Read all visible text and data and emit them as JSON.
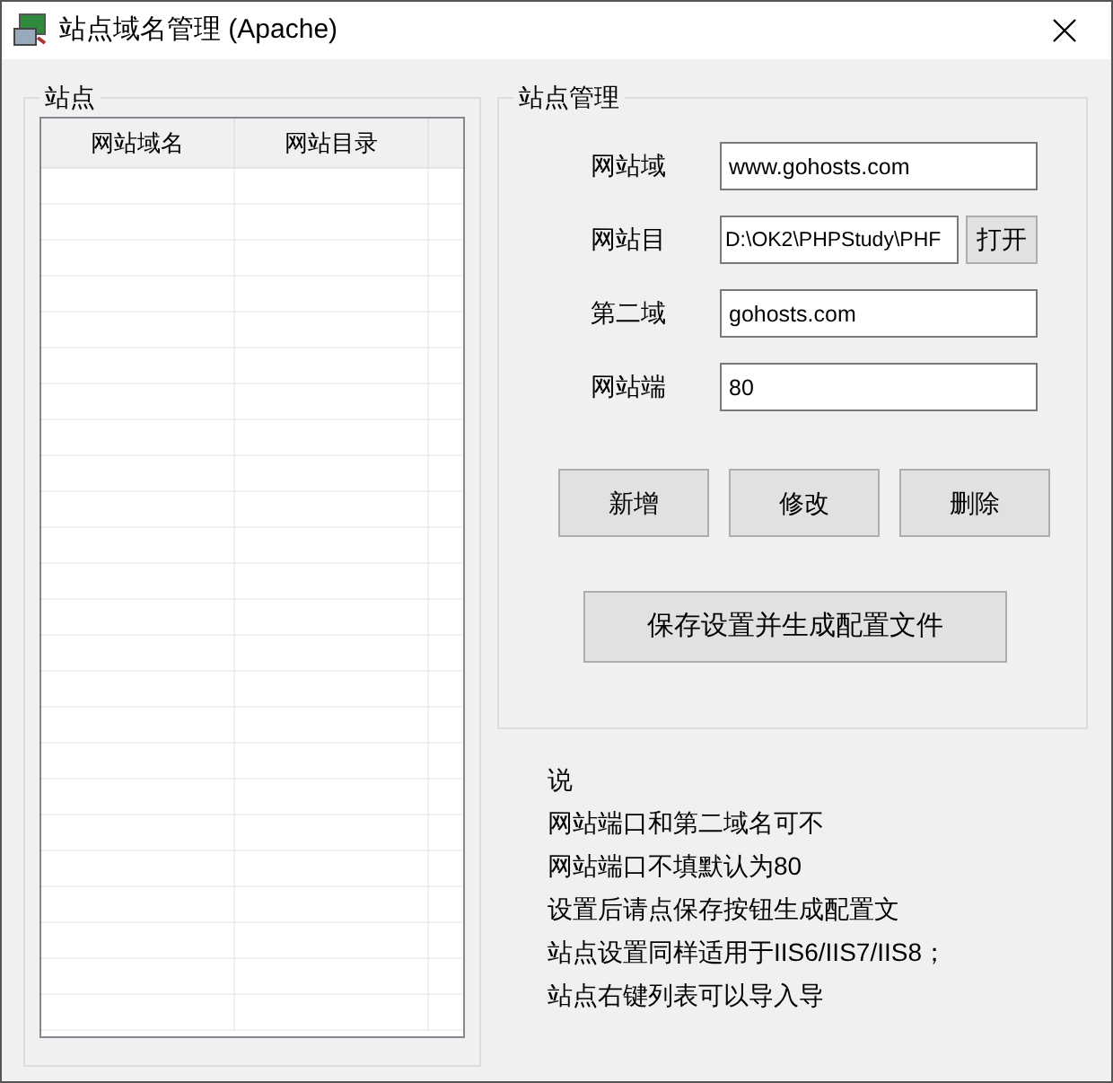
{
  "window": {
    "title": "站点域名管理 (Apache)"
  },
  "sites": {
    "title": "站点",
    "columns": [
      "网站域名",
      "网站目录"
    ]
  },
  "manage": {
    "title": "站点管理",
    "fields": [
      {
        "label": "网站域",
        "value": "www.gohosts.com"
      },
      {
        "label": "网站目",
        "value": "D:\\OK2\\PHPStudy\\PHF",
        "button": "打开"
      },
      {
        "label": "第二域",
        "value": "gohosts.com"
      },
      {
        "label": "网站端",
        "value": "80"
      }
    ],
    "buttons": [
      "新增",
      "修改",
      "删除"
    ],
    "save_button": "保存设置并生成配置文件"
  },
  "notes": [
    "说",
    "网站端口和第二域名可不",
    "网站端口不填默认为80",
    "设置后请点保存按钮生成配置文",
    "站点设置同样适用于IIS6/IIS7/IIS8；",
    "站点右键列表可以导入导"
  ]
}
